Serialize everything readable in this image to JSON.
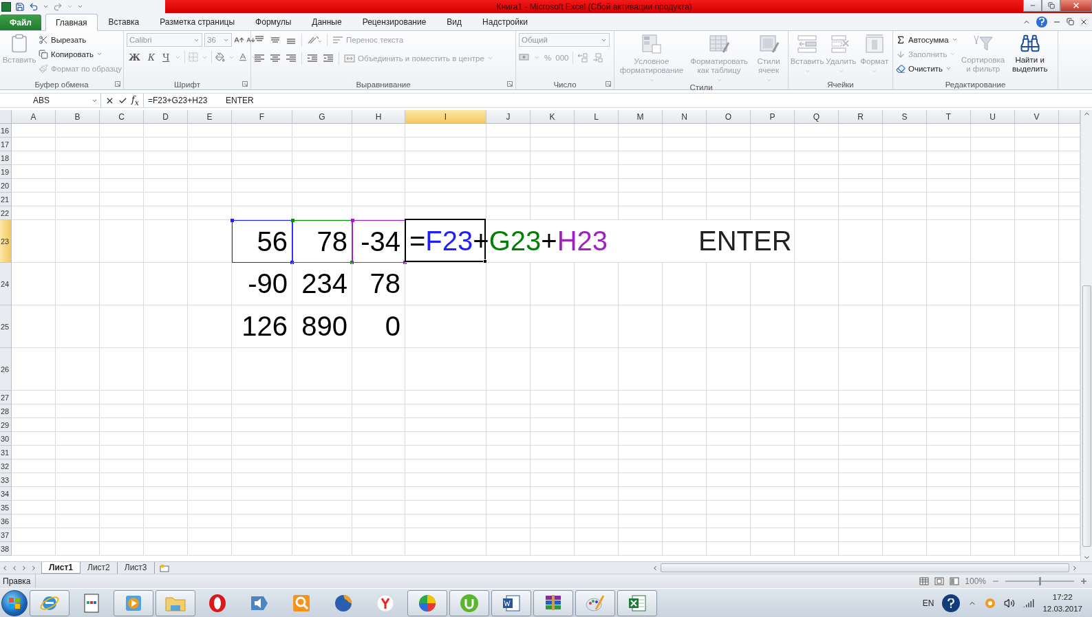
{
  "window": {
    "title": "Книга1  -  Microsoft Excel (Сбой активации продукта)"
  },
  "menu_tabs": [
    {
      "label": "Файл",
      "kind": "file",
      "selected": false
    },
    {
      "label": "Главная",
      "kind": "tab",
      "selected": true
    },
    {
      "label": "Вставка",
      "kind": "tab",
      "selected": false
    },
    {
      "label": "Разметка страницы",
      "kind": "tab",
      "selected": false
    },
    {
      "label": "Формулы",
      "kind": "tab",
      "selected": false
    },
    {
      "label": "Данные",
      "kind": "tab",
      "selected": false
    },
    {
      "label": "Рецензирование",
      "kind": "tab",
      "selected": false
    },
    {
      "label": "Вид",
      "kind": "tab",
      "selected": false
    },
    {
      "label": "Надстройки",
      "kind": "tab",
      "selected": false
    }
  ],
  "ribbon": {
    "clipboard": {
      "title": "Буфер обмена",
      "paste": {
        "label": "Вставить",
        "disabled": true
      },
      "cut": {
        "label": "Вырезать",
        "disabled": false
      },
      "copy": {
        "label": "Копировать",
        "disabled": false
      },
      "format_painter": {
        "label": "Формат по образцу",
        "disabled": true
      }
    },
    "font": {
      "title": "Шрифт",
      "font_name": {
        "value": "Calibri",
        "disabled": true
      },
      "font_size": {
        "value": "36",
        "disabled": true
      },
      "bold": "Ж",
      "italic": "К",
      "underline": "Ч"
    },
    "alignment": {
      "title": "Выравнивание",
      "wrap_text": {
        "label": "Перенос текста",
        "disabled": true
      },
      "merge": {
        "label": "Объединить и поместить в центре",
        "disabled": true
      }
    },
    "number": {
      "title": "Число",
      "format": {
        "value": "Общий",
        "disabled": true
      },
      "percent": "%",
      "thousands": "000"
    },
    "styles": {
      "title": "Стили",
      "buttons": [
        {
          "label": "Условное форматирование",
          "disabled": true
        },
        {
          "label": "Форматировать как таблицу",
          "disabled": true
        },
        {
          "label": "Стили ячеек",
          "disabled": true
        }
      ]
    },
    "cells": {
      "title": "Ячейки",
      "buttons": [
        {
          "label": "Вставить",
          "disabled": true
        },
        {
          "label": "Удалить",
          "disabled": true
        },
        {
          "label": "Формат",
          "disabled": true
        }
      ]
    },
    "editing": {
      "title": "Редактирование",
      "autosum": {
        "label": "Автосумма",
        "disabled": false
      },
      "fill": {
        "label": "Заполнить",
        "disabled": true
      },
      "clear": {
        "label": "Очистить",
        "disabled": false
      },
      "sort": {
        "label": "Сортировка и фильтр",
        "disabled": true
      },
      "find": {
        "label": "Найти и выделить",
        "disabled": false
      }
    }
  },
  "formula_bar": {
    "name_box": "ABS",
    "insert_function": "f$_{x}$",
    "value": "=F23+G23+H23        ENTER"
  },
  "sheet": {
    "columns": [
      {
        "label": "A",
        "selected": false
      },
      {
        "label": "B",
        "selected": false
      },
      {
        "label": "C",
        "selected": false
      },
      {
        "label": "D",
        "selected": false
      },
      {
        "label": "E",
        "selected": false
      },
      {
        "label": "F",
        "selected": false
      },
      {
        "label": "G",
        "selected": false
      },
      {
        "label": "H",
        "selected": false
      },
      {
        "label": "I",
        "selected": true
      },
      {
        "label": "J",
        "selected": false
      },
      {
        "label": "K",
        "selected": false
      },
      {
        "label": "L",
        "selected": false
      },
      {
        "label": "M",
        "selected": false
      },
      {
        "label": "N",
        "selected": false
      },
      {
        "label": "O",
        "selected": false
      },
      {
        "label": "P",
        "selected": false
      },
      {
        "label": "Q",
        "selected": false
      },
      {
        "label": "R",
        "selected": false
      },
      {
        "label": "S",
        "selected": false
      },
      {
        "label": "T",
        "selected": false
      },
      {
        "label": "U",
        "selected": false
      },
      {
        "label": "V",
        "selected": false
      }
    ],
    "rows": [
      {
        "label": "16",
        "kind": "normal",
        "selected": false
      },
      {
        "label": "17",
        "kind": "normal",
        "selected": false
      },
      {
        "label": "18",
        "kind": "normal",
        "selected": false
      },
      {
        "label": "19",
        "kind": "normal",
        "selected": false
      },
      {
        "label": "20",
        "kind": "normal",
        "selected": false
      },
      {
        "label": "21",
        "kind": "normal",
        "selected": false
      },
      {
        "label": "22",
        "kind": "normal",
        "selected": false
      },
      {
        "label": "23",
        "kind": "tall",
        "selected": true,
        "values": [
          {
            "text": "56",
            "color": "#1f1fff"
          },
          {
            "text": "78",
            "color": "#009a00"
          },
          {
            "text": "-34",
            "color": "#a020c0"
          }
        ],
        "formula": [
          {
            "text": "=",
            "color": "#000000"
          },
          {
            "text": "F23",
            "color": "#1f1fff"
          },
          {
            "text": "+",
            "color": "#000000"
          },
          {
            "text": "G23",
            "color": "#008000"
          },
          {
            "text": "+",
            "color": "#000000"
          },
          {
            "text": "H23",
            "color": "#a020c0"
          }
        ],
        "note": "ENTER"
      },
      {
        "label": "24",
        "kind": "tall",
        "selected": false,
        "values": [
          {
            "text": "-90"
          },
          {
            "text": "234"
          },
          {
            "text": "78"
          }
        ]
      },
      {
        "label": "25",
        "kind": "tall",
        "selected": false,
        "values": [
          {
            "text": "126"
          },
          {
            "text": "890"
          },
          {
            "text": "0"
          }
        ]
      },
      {
        "label": "26",
        "kind": "tall",
        "selected": false
      },
      {
        "label": "27",
        "kind": "normal",
        "selected": false
      },
      {
        "label": "28",
        "kind": "normal",
        "selected": false
      },
      {
        "label": "29",
        "kind": "normal",
        "selected": false
      },
      {
        "label": "30",
        "kind": "normal",
        "selected": false
      },
      {
        "label": "31",
        "kind": "normal",
        "selected": false
      },
      {
        "label": "32",
        "kind": "normal",
        "selected": false
      },
      {
        "label": "33",
        "kind": "normal",
        "selected": false
      },
      {
        "label": "34",
        "kind": "normal",
        "selected": false
      },
      {
        "label": "35",
        "kind": "normal",
        "selected": false
      },
      {
        "label": "36",
        "kind": "normal",
        "selected": false
      },
      {
        "label": "37",
        "kind": "normal",
        "selected": false
      },
      {
        "label": "38",
        "kind": "normal",
        "selected": false
      }
    ]
  },
  "sheet_tabs": [
    {
      "label": "Лист1",
      "selected": true
    },
    {
      "label": "Лист2",
      "selected": false
    },
    {
      "label": "Лист3",
      "selected": false
    }
  ],
  "status_bar": {
    "mode": "Правка",
    "zoom": "100%",
    "zoom_slider": {
      "level": 0.5
    }
  },
  "taskbar": {
    "language": "EN",
    "time": "17:22",
    "date": "12.03.2017"
  }
}
